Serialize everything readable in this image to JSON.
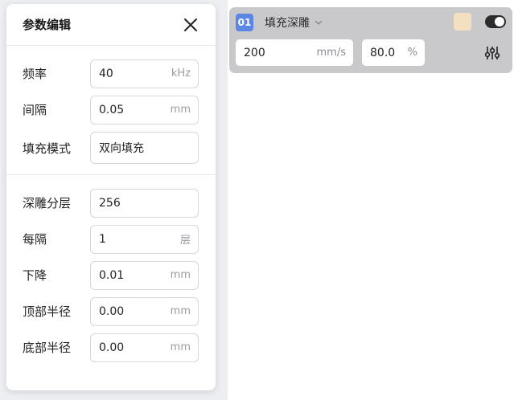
{
  "panel": {
    "title": "参数编辑",
    "sections": [
      {
        "rows": [
          {
            "label": "频率",
            "value": "40",
            "unit": "kHz"
          },
          {
            "label": "间隔",
            "value": "0.05",
            "unit": "mm"
          },
          {
            "label": "填充模式",
            "value": "双向填充",
            "unit": ""
          }
        ]
      },
      {
        "rows": [
          {
            "label": "深雕分层",
            "value": "256",
            "unit": ""
          },
          {
            "label": "每隔",
            "value": "1",
            "unit": "层"
          },
          {
            "label": "下降",
            "value": "0.01",
            "unit": "mm"
          },
          {
            "label": "顶部半径",
            "value": "0.00",
            "unit": "mm"
          },
          {
            "label": "底部半径",
            "value": "0.00",
            "unit": "mm"
          }
        ]
      }
    ]
  },
  "layer": {
    "number": "01",
    "name": "填充深雕",
    "color": "#f3e0c0",
    "enabled": true,
    "speed": {
      "value": "200",
      "unit": "mm/s"
    },
    "power": {
      "value": "80.0",
      "unit": "%"
    }
  }
}
